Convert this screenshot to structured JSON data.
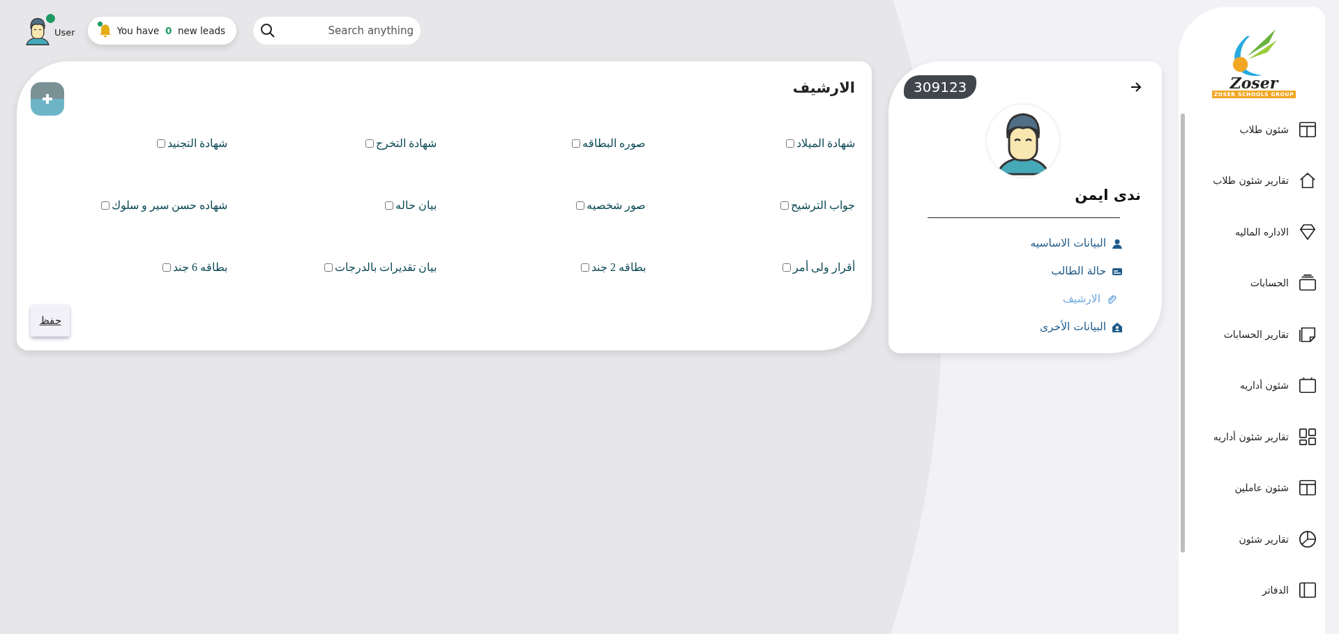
{
  "top_bar": {
    "user": {
      "name": "User",
      "online": true
    },
    "leads": {
      "prefix": "You have",
      "count": "0",
      "suffix": "new leads",
      "unread": true
    },
    "search": {
      "placeholder": "Search anything"
    }
  },
  "archive": {
    "title": "الارشيف",
    "items": [
      {
        "label": "شهادة الميلاد",
        "checked": false
      },
      {
        "label": "صوره البطاقه",
        "checked": false
      },
      {
        "label": "شهادة التخرج",
        "checked": false
      },
      {
        "label": "شهادة التجنيد",
        "checked": false
      },
      {
        "label": "جواب الترشيح",
        "checked": false
      },
      {
        "label": "صور شخصيه",
        "checked": false
      },
      {
        "label": "بيان حاله",
        "checked": false
      },
      {
        "label": "شهاده حسن سير و سلوك",
        "checked": false
      },
      {
        "label": "أقرار ولى أمر",
        "checked": false
      },
      {
        "label": "بطاقه 2 جند",
        "checked": false
      },
      {
        "label": "بيان تقديرات بالدرجات",
        "checked": false
      },
      {
        "label": "بطاقه 6 جند",
        "checked": false
      }
    ],
    "save_button": "حفظ"
  },
  "profile": {
    "code": "309123",
    "name": "ندى ايمن",
    "nav": [
      {
        "label": "البيانات الاساسيه",
        "kind": "person",
        "selected": false
      },
      {
        "label": "حالة الطالب",
        "kind": "card",
        "selected": false
      },
      {
        "label": "الارشيف",
        "kind": "clip",
        "selected": true
      },
      {
        "label": "البيانات الأخرى",
        "kind": "house",
        "selected": false
      }
    ]
  },
  "sidebar": {
    "logo": {
      "word": "Zoser",
      "tagline": "ZOSER SCHOOLS GROUP"
    },
    "items": [
      {
        "label": "شئون طلاب",
        "kind": "window"
      },
      {
        "label": "تقارير شئون طلاب",
        "kind": "home"
      },
      {
        "label": "الاداره الماليه",
        "kind": "diamond"
      },
      {
        "label": "الحسابات",
        "kind": "stack"
      },
      {
        "label": "تقارير الحسابات",
        "kind": "note"
      },
      {
        "label": "شئون أداريه",
        "kind": "calendar"
      },
      {
        "label": "تقارير شئون أداريه",
        "kind": "grid"
      },
      {
        "label": "شئون عاملين",
        "kind": "window"
      },
      {
        "label": "تقارير شئون",
        "kind": "pie"
      },
      {
        "label": "الدفاتر",
        "kind": "panel"
      }
    ]
  }
}
